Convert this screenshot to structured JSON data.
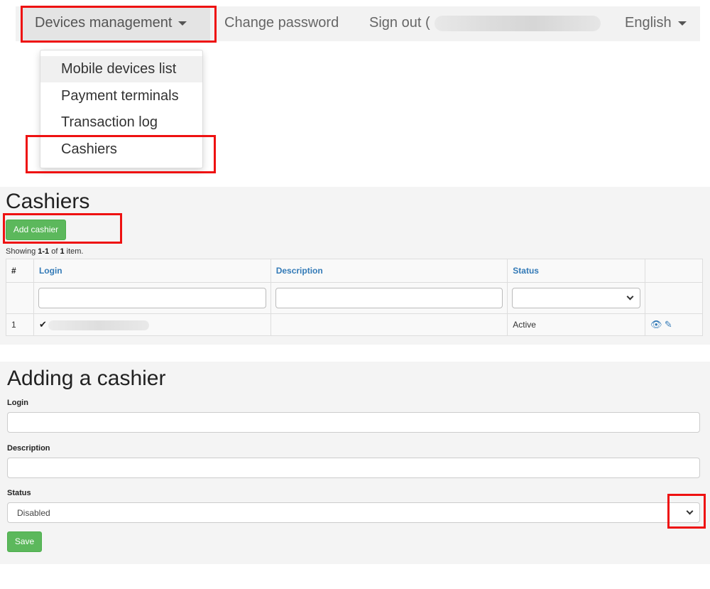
{
  "nav": {
    "devices_label": "Devices management",
    "change_password": "Change password",
    "sign_out": "Sign out (",
    "language": "English",
    "menu": [
      {
        "label": "Mobile devices list"
      },
      {
        "label": "Payment terminals"
      },
      {
        "label": "Transaction log"
      },
      {
        "label": "Cashiers"
      }
    ]
  },
  "list": {
    "title": "Cashiers",
    "add_button": "Add cashier",
    "summary_prefix": "Showing ",
    "summary_range": "1-1",
    "summary_of": " of ",
    "summary_total": "1",
    "summary_suffix": " item.",
    "columns": {
      "num": "#",
      "login": "Login",
      "description": "Description",
      "status": "Status"
    },
    "rows": [
      {
        "num": "1",
        "description": "",
        "status": "Active"
      }
    ]
  },
  "form": {
    "title": "Adding a cashier",
    "login_label": "Login",
    "description_label": "Description",
    "status_label": "Status",
    "status_value": "Disabled",
    "save_button": "Save"
  },
  "colors": {
    "highlight": "#ee1111",
    "success": "#5cb85c",
    "link": "#337ab7"
  }
}
